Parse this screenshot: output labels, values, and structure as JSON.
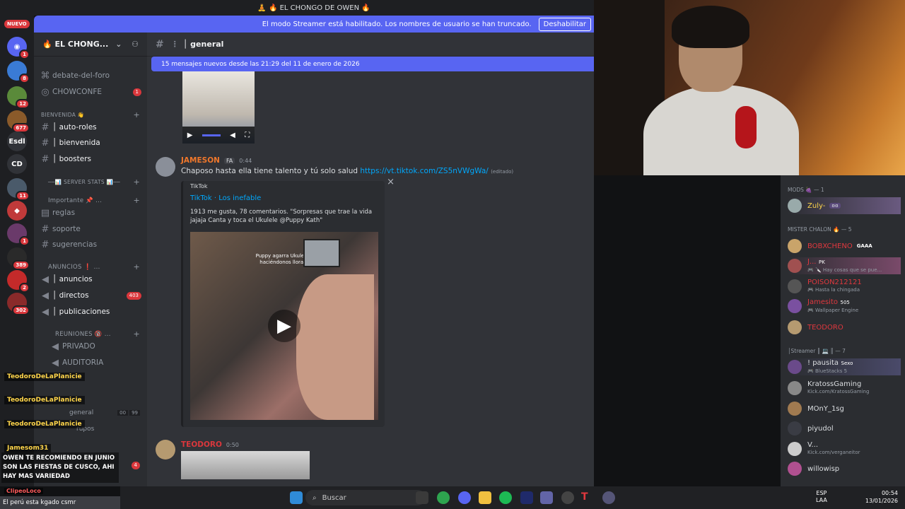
{
  "window_title": "🧘 🔥 EL CHONGO DE OWEN 🔥",
  "streamer_bar": {
    "text": "El modo Streamer está habilitado. Los nombres de usuario se han truncado.",
    "button": "Deshabilitar"
  },
  "rail": {
    "nuevo": "NUEVO",
    "servers": [
      {
        "label": "",
        "badge": "1"
      },
      {
        "label": "",
        "badge": "8"
      },
      {
        "label": "",
        "badge": "12"
      },
      {
        "label": "",
        "badge": "677"
      },
      {
        "label": "Esdl",
        "badge": ""
      },
      {
        "label": "CD",
        "badge": ""
      },
      {
        "label": "",
        "badge": "11"
      },
      {
        "label": "",
        "badge": ""
      },
      {
        "label": "",
        "badge": "1"
      },
      {
        "label": "",
        "badge": "389"
      },
      {
        "label": "",
        "badge": "2"
      },
      {
        "label": "",
        "badge": "302"
      }
    ]
  },
  "server": {
    "name": "🔥 EL CHONG...",
    "chevron": "⌄"
  },
  "channels": {
    "top": [
      {
        "name": "debate-del-foro"
      },
      {
        "name": "CHOWCONFE",
        "badge": "1"
      }
    ],
    "cat_bienvenida": "BIENVENIDA 👋",
    "bienvenida": [
      {
        "name": "│ auto-roles"
      },
      {
        "name": "│ bienvenida"
      },
      {
        "name": "│ boosters"
      }
    ],
    "cat_serverstats": "──📊 SERVER STATS 📊──",
    "cat_importante": "Importante 📌 ...",
    "importante": [
      {
        "name": "reglas"
      },
      {
        "name": "soporte"
      },
      {
        "name": "sugerencias"
      }
    ],
    "cat_anuncios": "ANUNCIOS ❗ ...",
    "anuncios": [
      {
        "name": "│ anuncios",
        "badge": ""
      },
      {
        "name": "│ directos",
        "badge": "403"
      },
      {
        "name": "│ publicaciones",
        "badge": ""
      }
    ],
    "cat_reuniones": "REUNIONES 🔞 ...",
    "reuniones": [
      {
        "name": "PRIVADO"
      },
      {
        "name": "AUDITORIA"
      }
    ],
    "extra": {
      "general": "general",
      "count_a": "00",
      "count_b": "99",
      "grupos": "rupos",
      "badge": "4"
    }
  },
  "chat": {
    "channel": "│ general",
    "new_messages": "15 mensajes nuevos desde las 21:29 del 11 de enero de 2026",
    "msg1": {
      "author": "JAMESON",
      "tag": "FA",
      "time": "0:44",
      "text": "Chaposo hasta ella tiene talento y tú solo salud",
      "link": "https://vt.tiktok.com/ZS5nVWgWa/",
      "edited": "(editado)"
    },
    "embed": {
      "provider": "TikTok",
      "title": "TikTok · Los inefable",
      "desc": "1913 me gusta, 78 comentarios. \"Sorpresas que trae la vida jajaja Canta y toca el Ukulele @Puppy Kath\"",
      "overlay_text": "Puppy agarra Ukulele Termina haciéndonos llorar A todos",
      "close": "×"
    },
    "msg2": {
      "author": "TEODORO",
      "time": "0:50"
    }
  },
  "members": {
    "cat_mods": "MODS 🍇 — 1",
    "mods": [
      {
        "name": "Zuly-",
        "tag": "ʚɞ",
        "status": ""
      }
    ],
    "cat_mister": "MISTER CHALON 🔥 — 5",
    "mister": [
      {
        "name": "BOBXCHENO",
        "tag": "GAAA",
        "status": "",
        "color": "#e0383e"
      },
      {
        "name": "J...",
        "tag": "PK",
        "status": "🎮 🔪 Hay cosas que se pue...",
        "color": "#e0383e"
      },
      {
        "name": "POISON212121",
        "tag": "",
        "status": "🎮 Hasta la chingada",
        "color": "#e0383e"
      },
      {
        "name": "Jamesito",
        "tag": "505",
        "status": "🎮 Wallpaper Engine",
        "color": "#e0383e"
      },
      {
        "name": "TEODORO",
        "tag": "",
        "status": "",
        "color": "#e0383e"
      }
    ],
    "cat_streamer": "│Streamer ║ 💻 ║ — 7",
    "streamer": [
      {
        "name": "! pausita",
        "tag": "Sexo",
        "status": "🎮 BlueStacks 5",
        "color": "#dbdee1"
      },
      {
        "name": "KratossGaming",
        "tag": "",
        "status": "Kick.com/KratossGaming",
        "color": "#dbdee1"
      },
      {
        "name": "MOnY_1sg",
        "tag": "",
        "status": "",
        "color": "#dbdee1"
      },
      {
        "name": "piyudol",
        "tag": "",
        "status": "",
        "color": "#dbdee1"
      },
      {
        "name": "V...",
        "tag": "",
        "status": "Kick.com/verganeitor",
        "color": "#dbdee1"
      },
      {
        "name": "willowisp",
        "tag": "",
        "status": "",
        "color": "#dbdee1"
      }
    ]
  },
  "overlay": {
    "names": [
      "TeodoroDeLaPlanicie",
      "TeodoroDeLaPlanicie",
      "TeodoroDeLaPlanicie",
      "Jamesom31"
    ],
    "message": "OWEN TE RECOMIENDO EN JUNIO SON LAS FIESTAS DE CUSCO, AHI HAY MAS VARIEDAD",
    "bottom_user": "ClipeoLoco",
    "bottom_text": "El perú esta kgado csmr"
  },
  "taskbar": {
    "search_placeholder": "Buscar",
    "lang": "ESP",
    "lang2": "LAA",
    "time": "00:54",
    "date": "13/01/2026"
  },
  "colors": {
    "accent": "#5865f2",
    "mention_red": "#da373c",
    "link": "#00a8fc",
    "author_orange": "#f0772b"
  }
}
